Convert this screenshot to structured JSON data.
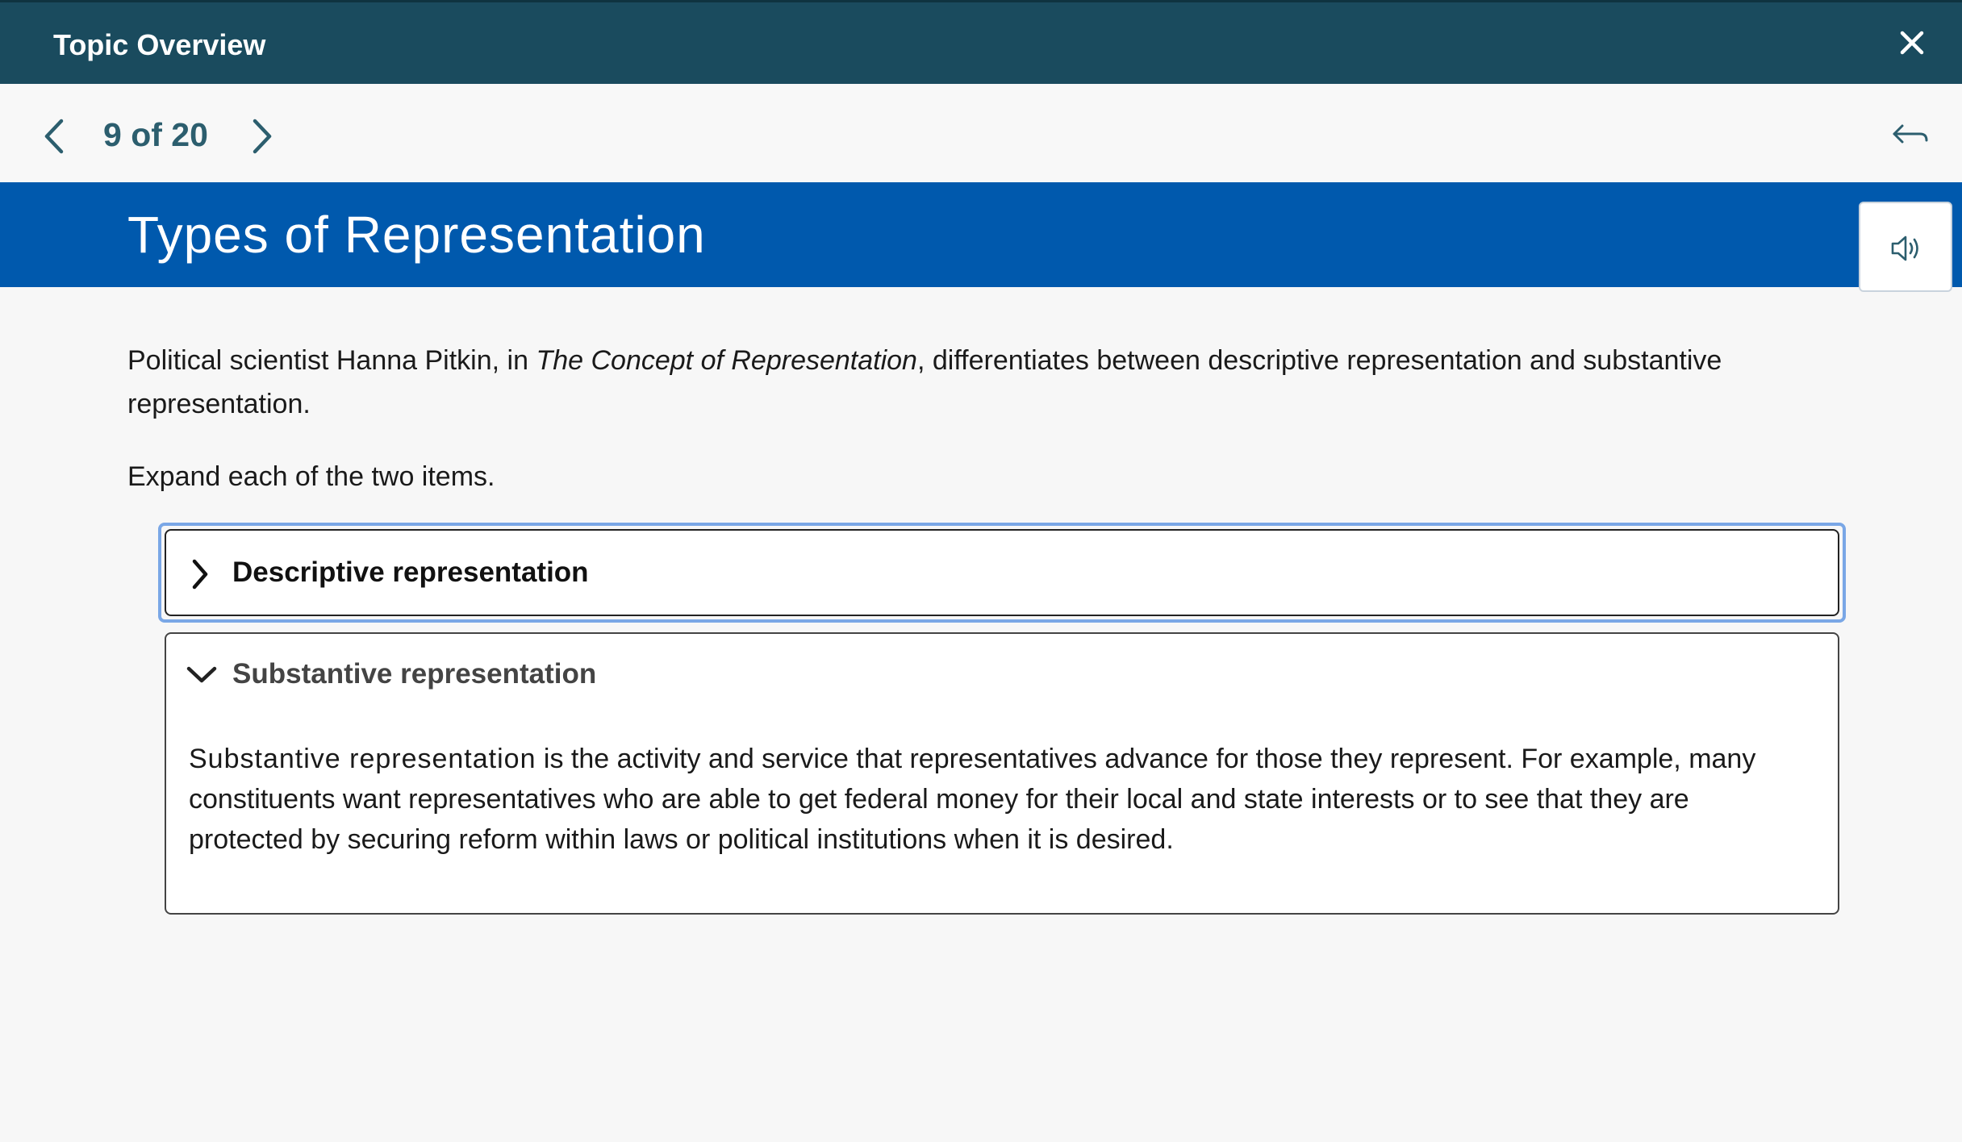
{
  "header": {
    "title": "Topic Overview",
    "close_icon": "close-icon"
  },
  "navigation": {
    "counter": "9 of 20",
    "prev_icon": "chevron-left-icon",
    "next_icon": "chevron-right-icon",
    "back_icon": "return-arrow-icon"
  },
  "banner": {
    "heading": "Types of Representation",
    "audio_icon": "speaker-icon"
  },
  "content": {
    "intro_before": "Political scientist Hanna Pitkin, in ",
    "intro_book": "The Concept of Representation",
    "intro_after": ", differentiates between descriptive representation and substantive representation.",
    "instruction": "Expand each of the two items."
  },
  "accordion": [
    {
      "label": "Descriptive representation",
      "expanded": false,
      "icon": "chevron-right-icon"
    },
    {
      "label": "Substantive representation",
      "expanded": true,
      "icon": "chevron-down-icon",
      "body_term": "Substantive representation",
      "body_text": " is the activity and service that representatives advance for those they represent. For example, many constituents want representatives who are able to get federal money for their local and state interests or to see that they are protected by securing reform within laws or political institutions when it is desired."
    }
  ],
  "colors": {
    "topbar": "#1a4b5e",
    "banner": "#0059ad",
    "nav_text": "#2c5e6e",
    "focus_ring": "#7aa7e6"
  }
}
